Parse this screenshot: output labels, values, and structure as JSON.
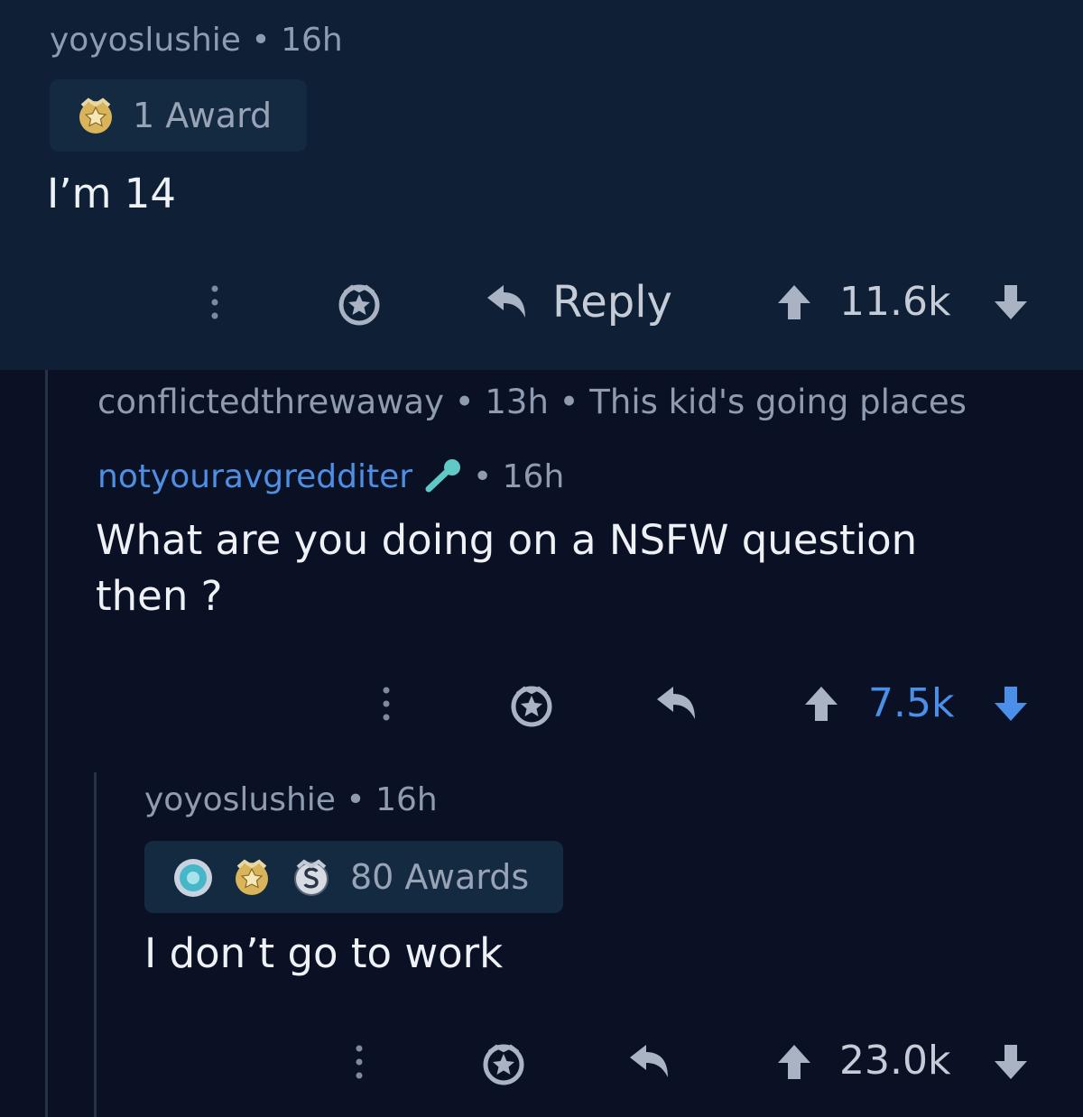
{
  "colors": {
    "top_bg": "#0f2036",
    "page_bg": "#0b1125",
    "meta_text": "#8f9bb0",
    "body_text": "#eef1f6",
    "upvoted_blue": "#4a8fe8",
    "op_link": "#4f8fe3",
    "mic_icon": "#5fc9c6",
    "gold_award": "#d9b45a"
  },
  "comment1": {
    "author": "yoyoslushie",
    "separator": "•",
    "age": "16h",
    "award_icon": "gold-award-icon",
    "award_label": "1 Award",
    "body": "I’m 14",
    "actions": {
      "more_icon": "more-vertical-icon",
      "award_icon": "give-award-icon",
      "reply_icon": "reply-arrow-icon",
      "reply_label": "Reply",
      "upvote_icon": "upvote-arrow-icon",
      "score": "11.6k",
      "downvote_icon": "downvote-arrow-icon"
    }
  },
  "collapsed_comment": {
    "author": "conflictedthrewaway",
    "separator1": "•",
    "age": "13h",
    "separator2": "•",
    "preview": "This kid's going places"
  },
  "comment2": {
    "author": "notyouravgredditer",
    "flair_icon": "microphone-icon",
    "separator": "•",
    "age": "16h",
    "body_line1": "What are you doing on a NSFW question",
    "body_line2": "then ?",
    "actions": {
      "more_icon": "more-vertical-icon",
      "award_icon": "give-award-icon",
      "reply_icon": "reply-arrow-icon",
      "upvote_icon": "upvote-arrow-icon",
      "score": "7.5k",
      "score_state": "upvoted",
      "downvote_icon": "downvote-arrow-icon"
    }
  },
  "comment3": {
    "author": "yoyoslushie",
    "separator": "•",
    "age": "16h",
    "award_icons": [
      "wholesome-award-icon",
      "gold-award-icon",
      "silver-award-icon"
    ],
    "award_label": "80 Awards",
    "body": "I don’t go to work",
    "actions": {
      "more_icon": "more-vertical-icon",
      "award_icon": "give-award-icon",
      "reply_icon": "reply-arrow-icon",
      "upvote_icon": "upvote-arrow-icon",
      "score": "23.0k",
      "downvote_icon": "downvote-arrow-icon"
    }
  }
}
